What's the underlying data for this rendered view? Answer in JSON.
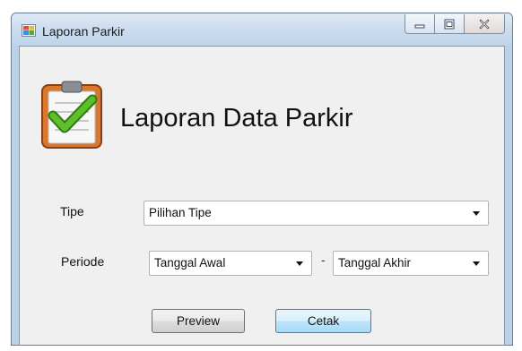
{
  "window": {
    "title": "Laporan Parkir",
    "controls": [
      "minimize-icon",
      "maximize-icon",
      "close-icon"
    ]
  },
  "header": {
    "icon": "clipboard-check-icon",
    "title": "Laporan Data Parkir"
  },
  "form": {
    "tipe": {
      "label": "Tipe",
      "value": "Pilihan Tipe"
    },
    "periode": {
      "label": "Periode",
      "start_value": "Tanggal Awal",
      "separator": "-",
      "end_value": "Tanggal Akhir"
    }
  },
  "buttons": {
    "preview": "Preview",
    "cetak": "Cetak"
  },
  "colors": {
    "titlebar": "#cbdcef",
    "client_background": "#f0f0f0",
    "checkmark": "#4aa51f",
    "clipboard": "#d9772f"
  }
}
